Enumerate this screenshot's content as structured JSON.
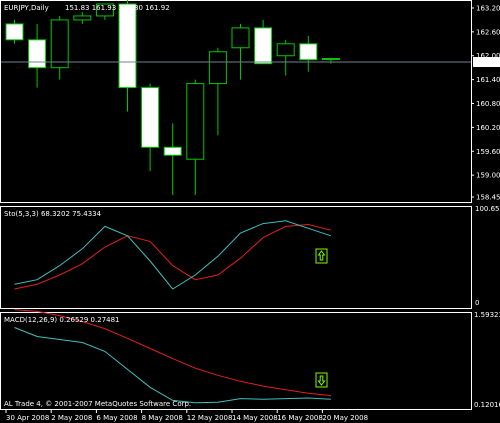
{
  "window": {
    "symbol_header": "EURJPY,Daily",
    "ohlc_header": "151.83 161.93 161.80 161.92",
    "copyright": "AL Trade 4, © 2001-2007 MetaQuotes Software Corp."
  },
  "colors": {
    "background": "#000000",
    "frame": "#ffffff",
    "bull_body": "#000000",
    "bear_body": "#ffffff",
    "wick": "#00c800",
    "price_line": "#708090",
    "stoch_main": "#40c0c0",
    "stoch_signal": "#e02020",
    "macd_main": "#40c0c0",
    "macd_signal": "#e02020",
    "arrow": "#7cfc00"
  },
  "x_axis": {
    "labels": [
      "30 Apr 2008",
      "2 May 2008",
      "6 May 2008",
      "8 May 2008",
      "12 May 2008",
      "14 May 2008",
      "16 May 2008",
      "20 May 2008"
    ]
  },
  "price_panel": {
    "current_price_label": "161.92",
    "scale": [
      "163.20",
      "162.60",
      "162.00",
      "161.40",
      "160.80",
      "160.20",
      "159.60",
      "159.00",
      "158.45"
    ],
    "candles": [
      {
        "o": 162.8,
        "h": 162.9,
        "l": 162.3,
        "c": 162.4
      },
      {
        "o": 162.4,
        "h": 162.8,
        "l": 161.2,
        "c": 161.7
      },
      {
        "o": 161.7,
        "h": 163.0,
        "l": 161.4,
        "c": 162.9
      },
      {
        "o": 162.9,
        "h": 163.1,
        "l": 162.8,
        "c": 163.0
      },
      {
        "o": 163.0,
        "h": 163.3,
        "l": 162.9,
        "c": 163.3
      },
      {
        "o": 163.3,
        "h": 163.4,
        "l": 160.6,
        "c": 161.2
      },
      {
        "o": 161.2,
        "h": 161.3,
        "l": 159.1,
        "c": 159.7
      },
      {
        "o": 159.7,
        "h": 160.3,
        "l": 158.5,
        "c": 159.5
      },
      {
        "o": 159.4,
        "h": 161.4,
        "l": 158.5,
        "c": 161.3
      },
      {
        "o": 161.3,
        "h": 162.2,
        "l": 160.0,
        "c": 162.1
      },
      {
        "o": 162.2,
        "h": 162.8,
        "l": 161.4,
        "c": 162.7
      },
      {
        "o": 162.7,
        "h": 162.9,
        "l": 161.8,
        "c": 161.8
      },
      {
        "o": 162.0,
        "h": 162.4,
        "l": 161.5,
        "c": 162.3
      },
      {
        "o": 162.3,
        "h": 162.5,
        "l": 161.6,
        "c": 161.9
      },
      {
        "o": 161.93,
        "h": 161.93,
        "l": 161.8,
        "c": 161.92
      }
    ]
  },
  "stoch_panel": {
    "header": "Sto(5,3,3) 68.3202 75.4334",
    "scale": [
      "100.65",
      "0"
    ],
    "main": [
      20,
      25,
      40,
      58,
      82,
      72,
      45,
      15,
      30,
      50,
      75,
      85,
      88,
      80,
      72
    ],
    "signal": [
      15,
      20,
      30,
      42,
      60,
      72,
      66,
      40,
      25,
      30,
      48,
      70,
      82,
      84,
      78
    ]
  },
  "macd_panel": {
    "header": "MACD(12,26,9) 0.26529 0.27481",
    "scale": [
      "1.59323",
      "0.12016"
    ],
    "main": [
      1.4,
      1.25,
      1.2,
      1.15,
      1.0,
      0.7,
      0.4,
      0.18,
      0.14,
      0.15,
      0.21,
      0.2,
      0.21,
      0.22,
      0.2
    ],
    "signal": [
      1.7,
      1.67,
      1.6,
      1.5,
      1.38,
      1.22,
      1.05,
      0.88,
      0.72,
      0.6,
      0.5,
      0.42,
      0.36,
      0.3,
      0.26
    ]
  }
}
